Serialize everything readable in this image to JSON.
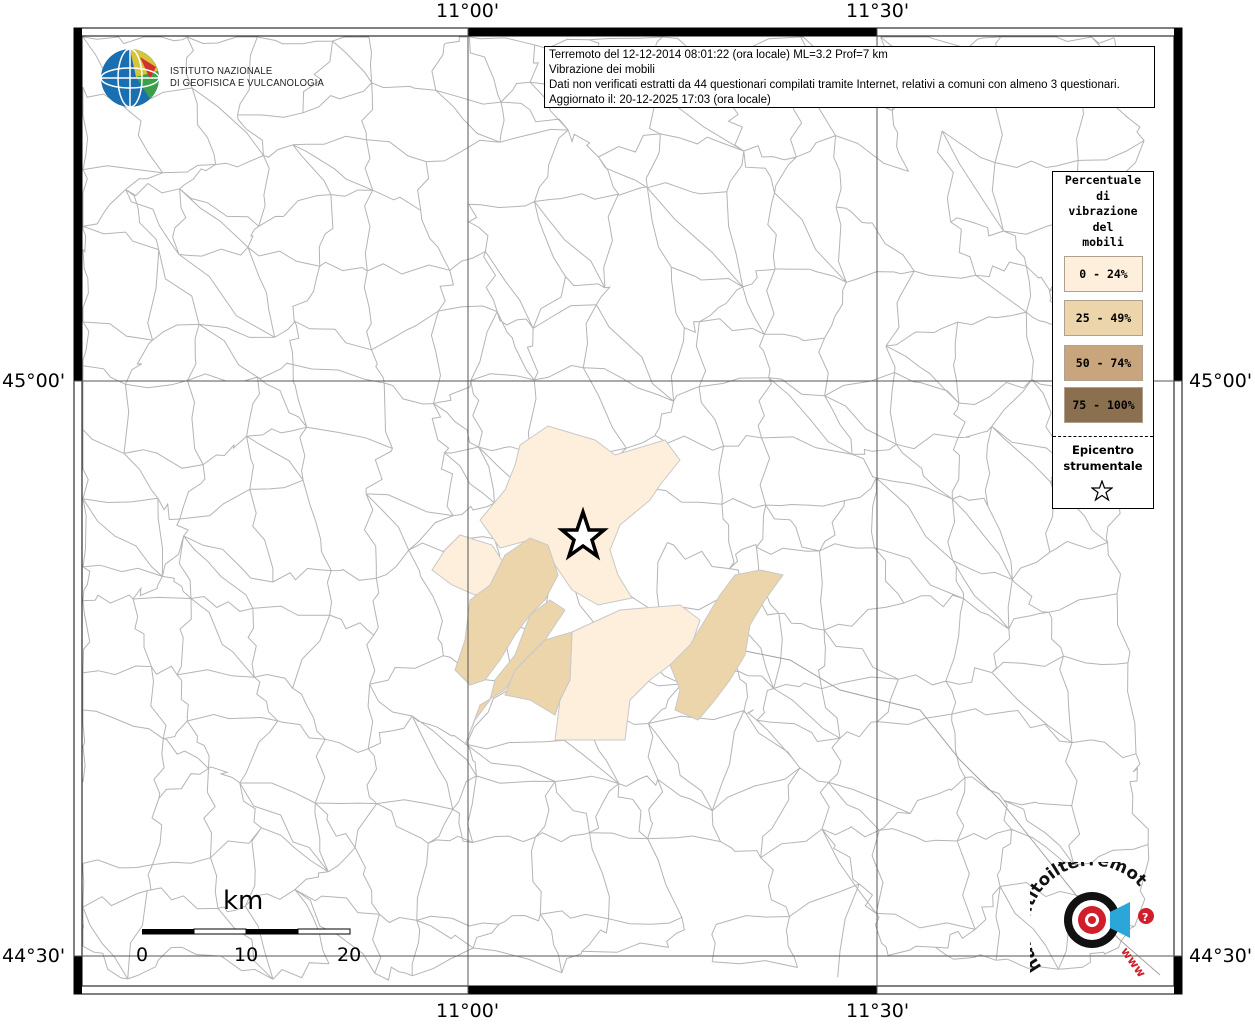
{
  "header": {
    "line1": "Terremoto del 12-12-2014 08:01:22 (ora locale) ML=3.2 Prof=7 km",
    "line2": "Vibrazione dei mobili",
    "line3": "Dati non verificati estratti da 44 questionari compilati tramite Internet, relativi a comuni con almeno 3 questionari.",
    "line4": "Aggiornato il: 20-12-2025 17:03 (ora locale)"
  },
  "logo": {
    "line1": "ISTITUTO NAZIONALE",
    "line2": "DI GEOFISICA E VULCANOLOGIA"
  },
  "coords": {
    "lon_left": "11°00'",
    "lon_right": "11°30'",
    "lat_top": "45°00'",
    "lat_bottom": "44°30'"
  },
  "legend": {
    "title": "Percentuale\ndi\nvibrazione\ndel\nmobili",
    "items": [
      {
        "label": "0 - 24%",
        "color": "#fdefdc"
      },
      {
        "label": "25 - 49%",
        "color": "#ecd5aa"
      },
      {
        "label": "50 - 74%",
        "color": "#c8a57d"
      },
      {
        "label": "75 - 100%",
        "color": "#8b7050"
      }
    ],
    "epicenter_line1": "Epicentro",
    "epicenter_line2": "strumentale"
  },
  "scale": {
    "title": "km",
    "labels": [
      "0",
      "10",
      "20"
    ]
  },
  "brand": {
    "name": "haisentitoilterremoto.it",
    "prefix": "www."
  },
  "colors": {
    "boundary": "#b4b4b4",
    "graticule": "#555555"
  }
}
